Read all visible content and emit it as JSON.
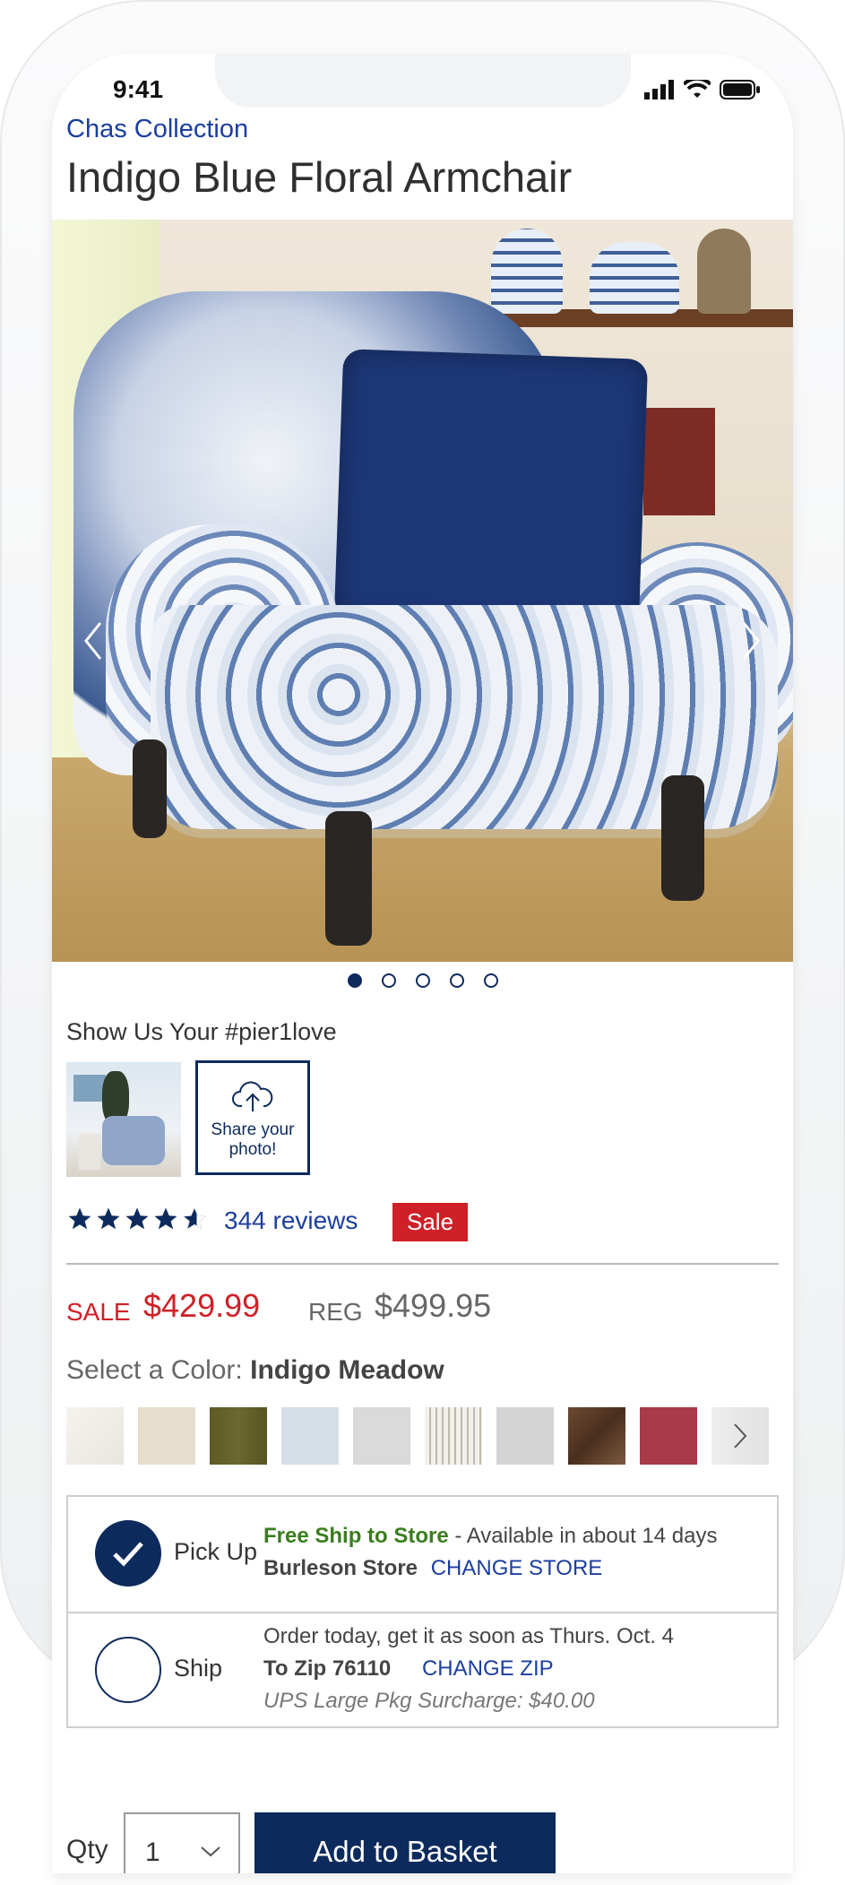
{
  "status_bar": {
    "time": "9:41"
  },
  "product": {
    "collection": "Chas Collection",
    "title": "Indigo Blue Floral Armchair",
    "carousel": {
      "count": 5,
      "active_index": 0
    }
  },
  "ugc": {
    "title": "Show Us Your #pier1love",
    "share_label": "Share your photo!"
  },
  "rating": {
    "stars": 4.5,
    "reviews_label": "344 reviews",
    "badge": "Sale"
  },
  "pricing": {
    "sale_label": "SALE",
    "sale_price": "$429.99",
    "reg_label": "REG",
    "reg_price": "$499.95"
  },
  "color": {
    "label": "Select a Color:",
    "selected": "Indigo Meadow",
    "swatches": [
      "#f1efea",
      "#e6ddcc",
      "#5d5a24",
      "#d5dde7",
      "#dadada",
      "striped-stone",
      "#d4d4d4",
      "#5a3a26",
      "#a93a47"
    ]
  },
  "fulfillment": {
    "pickup": {
      "label": "Pick Up",
      "highlight": "Free Ship to Store",
      "availability": "- Available in about 14 days",
      "store": "Burleson Store",
      "change_store": "CHANGE STORE",
      "selected": true
    },
    "ship": {
      "label": "Ship",
      "eta": "Order today, get it as soon as Thurs. Oct. 4",
      "zip": "To Zip 76110",
      "change_zip": "CHANGE ZIP",
      "surcharge": "UPS Large Pkg Surcharge: $40.00",
      "selected": false
    }
  },
  "purchase": {
    "qty_label": "Qty",
    "qty_value": "1",
    "add_button": "Add to Basket"
  },
  "colors": {
    "navy": "#0d2a5c",
    "link": "#1b3ea0",
    "sale_red": "#cf2027",
    "green": "#3a7d1f"
  }
}
